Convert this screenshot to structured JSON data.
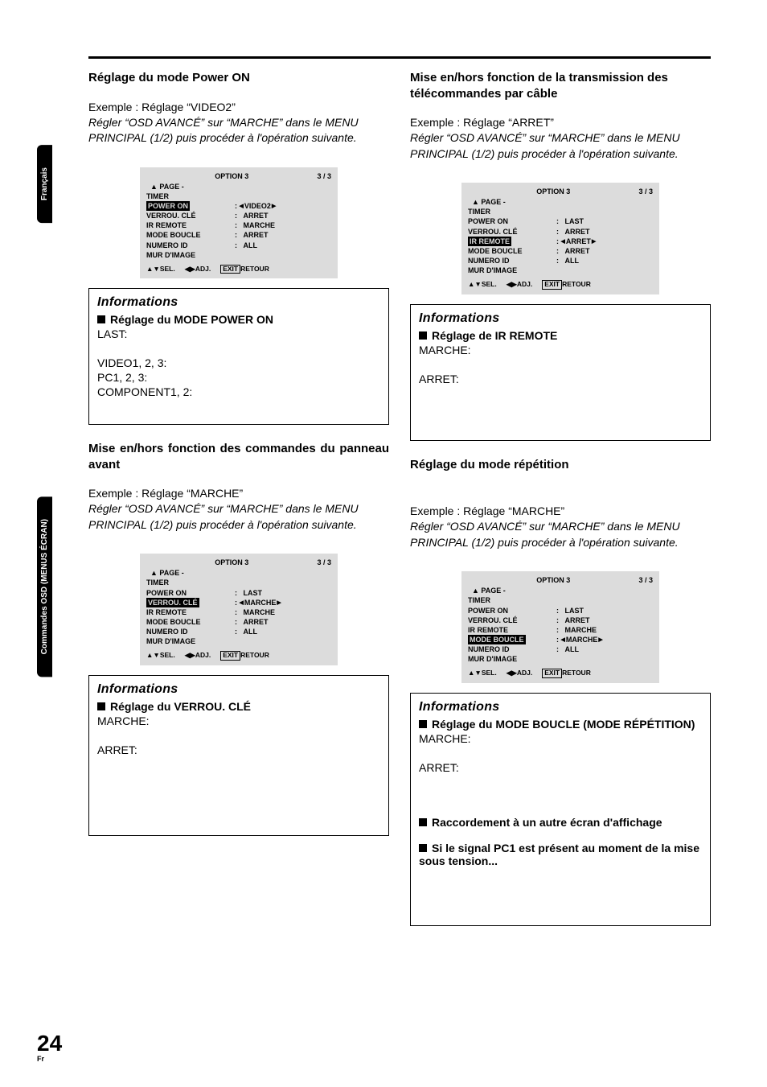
{
  "side_tabs": {
    "top": "Français",
    "bottom": "Commandes OSD (MENUS ÉCRAN)"
  },
  "page_number": {
    "big": "24",
    "small": "Fr"
  },
  "menu_common": {
    "title": "OPTION 3",
    "page_ind": "3 / 3",
    "page_label": "PAGE -",
    "rows_labels": [
      "TIMER",
      "POWER ON",
      "VERROU. CLÉ",
      "IR REMOTE",
      "MODE BOUCLE",
      "NUMERO ID",
      "MUR D'IMAGE"
    ],
    "foot_sel": "SEL.",
    "foot_adj": "ADJ.",
    "foot_exit": "EXIT",
    "foot_ret": "RETOUR"
  },
  "left": {
    "sec1": {
      "title": "Réglage du mode Power ON",
      "example_prefix": "Exemple : Réglage ",
      "example_value": "“VIDEO2”",
      "intro": "Régler “OSD AVANCÉ” sur “MARCHE” dans le MENU PRINCIPAL (1/2) puis procéder à l'opération suivante.",
      "menu_values": {
        "POWER_ON": "VIDEO2",
        "VERROU_CLE": "ARRET",
        "IR_REMOTE": "MARCHE",
        "MODE_BOUCLE": "ARRET",
        "NUMERO_ID": "ALL"
      },
      "menu_highlight": "POWER ON",
      "info_title": "Informations",
      "info_sub": "Réglage du MODE POWER ON",
      "info_lines": [
        "LAST:",
        "",
        "VIDEO1, 2, 3:",
        "PC1, 2, 3:",
        "COMPONENT1, 2:"
      ]
    },
    "sec2": {
      "title": "Mise en/hors fonction des commandes du panneau avant",
      "example_prefix": "Exemple : Réglage ",
      "example_value": "“MARCHE”",
      "intro": "Régler “OSD AVANCÉ” sur “MARCHE” dans le MENU PRINCIPAL (1/2) puis procéder à l'opération suivante.",
      "menu_values": {
        "POWER_ON": "LAST",
        "VERROU_CLE": "MARCHE",
        "IR_REMOTE": "MARCHE",
        "MODE_BOUCLE": "ARRET",
        "NUMERO_ID": "ALL"
      },
      "menu_highlight": "VERROU. CLÉ",
      "info_title": "Informations",
      "info_sub": "Réglage du VERROU. CLÉ",
      "info_lines": [
        "MARCHE:",
        "",
        "ARRET:"
      ]
    }
  },
  "right": {
    "sec1": {
      "title": "Mise en/hors fonction de la transmission des télécommandes par câble",
      "example_prefix": "Exemple : Réglage ",
      "example_value": "“ARRET”",
      "intro": "Régler “OSD AVANCÉ” sur “MARCHE” dans le MENU PRINCIPAL (1/2) puis procéder à l'opération suivante.",
      "menu_values": {
        "POWER_ON": "LAST",
        "VERROU_CLE": "ARRET",
        "IR_REMOTE": "ARRET",
        "MODE_BOUCLE": "ARRET",
        "NUMERO_ID": "ALL"
      },
      "menu_highlight": "IR REMOTE",
      "info_title": "Informations",
      "info_sub": "Réglage de IR REMOTE",
      "info_lines": [
        "MARCHE:",
        "",
        "ARRET:"
      ]
    },
    "sec2": {
      "title": "Réglage du mode répétition",
      "example_prefix": "Exemple : Réglage ",
      "example_value": "“MARCHE”",
      "intro": "Régler “OSD AVANCÉ” sur “MARCHE” dans le MENU PRINCIPAL (1/2) puis procéder à l'opération suivante.",
      "menu_values": {
        "POWER_ON": "LAST",
        "VERROU_CLE": "ARRET",
        "IR_REMOTE": "MARCHE",
        "MODE_BOUCLE": "MARCHE",
        "NUMERO_ID": "ALL"
      },
      "menu_highlight": "MODE BOUCLE",
      "info_title": "Informations",
      "info_sub": "Réglage du MODE BOUCLE (MODE RÉPÉTITION)",
      "info_lines": [
        "MARCHE:",
        "",
        "ARRET:"
      ],
      "extra_subs": [
        "Raccordement à un autre écran d'affichage",
        "Si le signal PC1 est présent au moment de la mise sous tension..."
      ]
    }
  }
}
